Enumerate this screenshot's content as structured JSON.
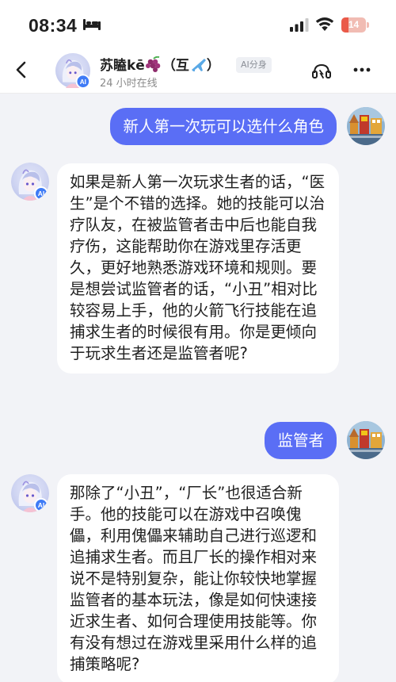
{
  "status_bar": {
    "time": "08:34",
    "battery_level": "14",
    "battery_fraction": 0.14
  },
  "header": {
    "name": "苏瞌kē",
    "name_suffix": "（互",
    "name_end": "）",
    "ai_tag": "AI分身",
    "status": "24 小时在线"
  },
  "messages": [
    {
      "sender": "user",
      "text": "新人第一次玩可以选什么角色"
    },
    {
      "sender": "ai",
      "text": "如果是新人第一次玩求生者的话，“医生”是个不错的选择。她的技能可以治疗队友，在被监管者击中后也能自我疗伤，这能帮助你在游戏里存活更久，更好地熟悉游戏环境和规则。要是想尝试监管者的话，“小丑”相对比较容易上手，他的火箭飞行技能在追捕求生者的时候很有用。你是更倾向于玩求生者还是监管者呢?"
    },
    {
      "sender": "user",
      "text": "监管者"
    },
    {
      "sender": "ai",
      "text": "那除了“小丑”，“厂长”也很适合新手。他的技能可以在游戏中召唤傀儡，利用傀儡来辅助自己进行巡逻和追捕求生者。而且厂长的操作相对来说不是特别复杂，能让你较快地掌握监管者的基本玩法，像是如何快速接近求生者、如何合理使用技能等。你有没有想过在游戏里采用什么样的追捕策略呢?"
    }
  ],
  "colors": {
    "user_bubble": "#5a6ef5",
    "ai_bubble": "#ffffff",
    "chat_bg": "#f2f3f7",
    "battery_red": "#ea5a49"
  }
}
